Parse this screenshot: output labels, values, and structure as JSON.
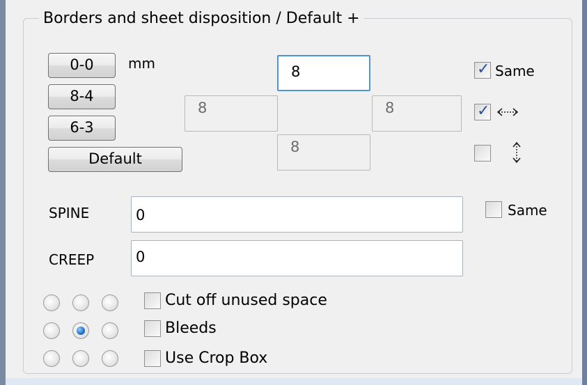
{
  "group": {
    "title": "Borders and sheet disposition / Default +"
  },
  "presets": {
    "btn_0_0": "0-0",
    "btn_8_4": "8-4",
    "btn_6_3": "6-3",
    "btn_default": "Default",
    "unit_label": "mm"
  },
  "margins": {
    "top": "8",
    "left": "8",
    "right": "8",
    "bottom": "8"
  },
  "options": {
    "same_label": "Same",
    "same_checked": true,
    "horizontal_checked": true,
    "vertical_checked": false,
    "horizontal_icon": "horizontal-arrows-icon",
    "vertical_icon": "vertical-arrows-icon"
  },
  "spine": {
    "label": "SPINE",
    "value": "0",
    "same_label": "Same",
    "same_checked": false
  },
  "creep": {
    "label": "CREEP",
    "value": "0"
  },
  "flags": {
    "cut_off_label": "Cut off unused space",
    "bleeds_label": "Bleeds",
    "crop_box_label": "Use Crop Box",
    "cut_off_checked": false,
    "bleeds_checked": false,
    "crop_box_checked": false
  },
  "anchor": {
    "selected": "center"
  }
}
